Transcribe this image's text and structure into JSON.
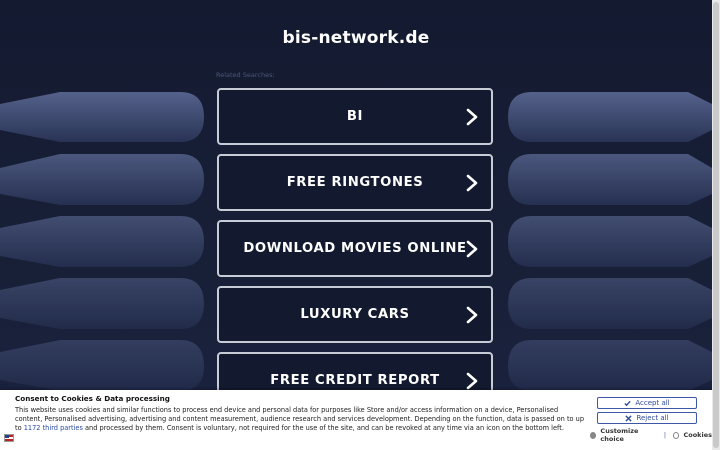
{
  "site": {
    "title": "bis-network.de"
  },
  "related": {
    "label": "Related Searches:"
  },
  "links": [
    {
      "label": "BI"
    },
    {
      "label": "FREE RINGTONES"
    },
    {
      "label": "DOWNLOAD MOVIES ONLINE"
    },
    {
      "label": "LUXURY CARS"
    },
    {
      "label": "FREE CREDIT REPORT"
    }
  ],
  "consent": {
    "title": "Consent to Cookies & Data processing",
    "text_before": "This website uses cookies and similar functions to process end device and personal data for purposes like Store and/or access information on a device, Personalised content, Personalised advertising, advertising and content measurement, audience research and services development. Depending on the function, data is passed on to up to ",
    "link_text": "1172 third parties",
    "text_after": " and processed by them. Consent is voluntary, not required for the use of the site, and can be revoked at any time via an icon on the bottom left.",
    "accept_label": "Accept all",
    "reject_label": "Reject all",
    "customize_label": "Customize choice",
    "separator": "|",
    "cookies_label": "Cookies"
  },
  "icons": {
    "chevron": "chevron-right-icon",
    "check": "check-icon",
    "close": "close-icon",
    "flag": "us-flag-icon"
  },
  "colors": {
    "background": "#151c33",
    "decor": "#4c5a84",
    "link_border": "#c7ccd6",
    "button_blue": "#2e4a9e"
  }
}
